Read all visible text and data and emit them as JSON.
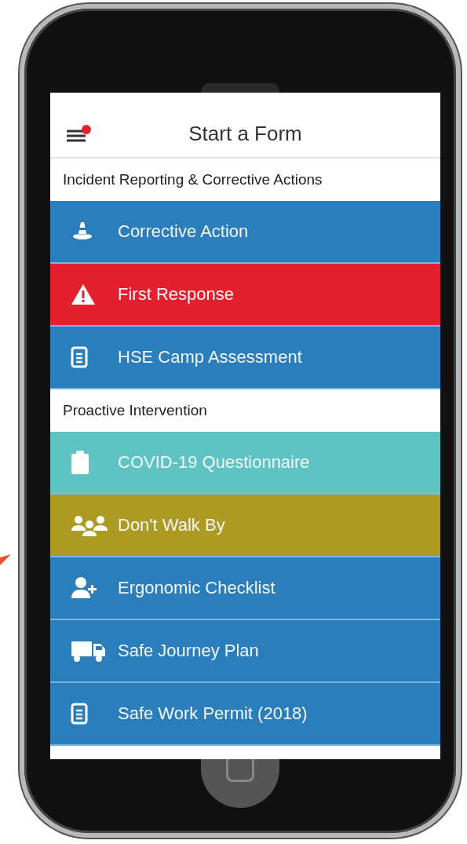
{
  "header": {
    "title": "Start a Form",
    "menu_badge": true
  },
  "sections": [
    {
      "heading": "Incident Reporting & Corrective Actions",
      "items": [
        {
          "label": "Corrective Action",
          "kind": "cone",
          "color": "#2a7ebc"
        },
        {
          "label": "First Response",
          "kind": "warning",
          "color": "#e3202e"
        },
        {
          "label": "HSE Camp Assessment",
          "kind": "document",
          "color": "#2a7ebc"
        }
      ]
    },
    {
      "heading": "Proactive Intervention",
      "items": [
        {
          "label": "COVID-19 Questionnaire",
          "kind": "clipboard",
          "color": "#5fc3c4"
        },
        {
          "label": "Don't Walk By",
          "kind": "group",
          "color": "#ad9a22"
        },
        {
          "label": "Ergonomic Checklist",
          "kind": "person-add",
          "color": "#2a7ebc"
        },
        {
          "label": "Safe Journey Plan",
          "kind": "truck",
          "color": "#2a7ebc"
        },
        {
          "label": "Safe Work Permit (2018)",
          "kind": "document",
          "color": "#2a7ebc"
        }
      ]
    }
  ]
}
